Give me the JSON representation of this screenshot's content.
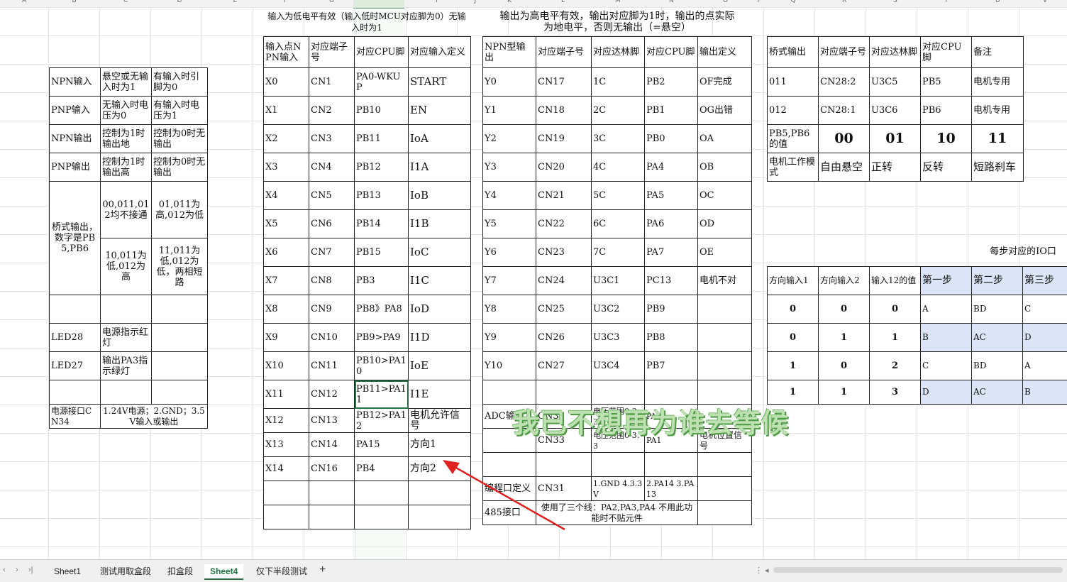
{
  "columns": [
    "A",
    "B",
    "C",
    "D",
    "E",
    "F",
    "G",
    "H",
    "I",
    "J",
    "K",
    "L",
    "M",
    "N",
    "O",
    "P",
    "Q",
    "R",
    "S",
    "T",
    "U",
    "V"
  ],
  "left_table": [
    [
      "NPN输入",
      "悬空或无输入时为1",
      "有输入时引脚为0"
    ],
    [
      "PNP输入",
      "无输入时电压为0",
      "有输入时电压为1"
    ],
    [
      "NPN输出",
      "控制为1时输出地",
      "控制为0时无输出"
    ],
    [
      "PNP输出",
      "控制为1时输出高",
      "控制为0时无输出"
    ],
    [
      "桥式输出，数字是PB5,PB6",
      "00,011,012均不接通",
      "01,011为高,012为低"
    ],
    [
      "",
      "10,011为低,012为高",
      "11,011为低,012为低，两相短路"
    ],
    [
      "",
      "",
      ""
    ],
    [
      "LED28",
      "电源指示红灯",
      ""
    ],
    [
      "LED27",
      "输出PA3指示绿灯",
      ""
    ],
    [
      "",
      "",
      ""
    ],
    [
      "电源接口CN34",
      "1.24V电源；2.GND；3.5V输入或输出",
      ""
    ]
  ],
  "input_title": "输入为低电平有效（输入低时MCU对应脚为0）无输入时为1",
  "input_headers": [
    "输入点NPN输入",
    "对应端子号",
    "对应CPU脚",
    "对应输入定义"
  ],
  "input_rows": [
    [
      "X0",
      "CN1",
      "PA0-WKUP",
      "START"
    ],
    [
      "X1",
      "CN2",
      "PB10",
      "EN"
    ],
    [
      "X2",
      "CN3",
      "PB11",
      "IoA"
    ],
    [
      "X3",
      "CN4",
      "PB12",
      "I1A"
    ],
    [
      "X4",
      "CN5",
      "PB13",
      "IoB"
    ],
    [
      "X5",
      "CN6",
      "PB14",
      "I1B"
    ],
    [
      "X6",
      "CN7",
      "PB15",
      "IoC"
    ],
    [
      "X7",
      "CN8",
      "PB3",
      "I1C"
    ],
    [
      "X8",
      "CN9",
      "PB8》PA8",
      "IoD"
    ],
    [
      "X9",
      "CN10",
      "PB9>PA9",
      "I1D"
    ],
    [
      "X10",
      "CN11",
      "PB10>PA10",
      "IoE"
    ],
    [
      "X11",
      "CN12",
      "PB11>PA11",
      "I1E"
    ],
    [
      "X12",
      "CN13",
      "PB12>PA12",
      "电机允许信号"
    ],
    [
      "X13",
      "CN14",
      "PA15",
      "方向1"
    ],
    [
      "X14",
      "CN16",
      "PB4",
      "方向2"
    ],
    [
      "",
      "",
      "",
      ""
    ],
    [
      "",
      "",
      "",
      ""
    ]
  ],
  "output_title": "输出为高电平有效，输出对应脚为1时，输出的点实际为地电平，否则无输出（=悬空）",
  "output_headers": [
    "NPN型输出",
    "对应端子号",
    "对应达林脚",
    "对应CPU脚",
    "输出定义"
  ],
  "output_rows": [
    [
      "Y0",
      "CN17",
      "1C",
      "PB2",
      "OF完成"
    ],
    [
      "Y1",
      "CN18",
      "2C",
      "PB1",
      "OG出错"
    ],
    [
      "Y2",
      "CN19",
      "3C",
      "PB0",
      "OA"
    ],
    [
      "Y3",
      "CN20",
      "4C",
      "PA4",
      "OB"
    ],
    [
      "Y4",
      "CN21",
      "5C",
      "PA5",
      "OC"
    ],
    [
      "Y5",
      "CN22",
      "6C",
      "PA6",
      "OD"
    ],
    [
      "Y6",
      "CN23",
      "7C",
      "PA7",
      "OE"
    ],
    [
      "Y7",
      "CN24",
      "U3C1",
      "PC13",
      "电机不对"
    ],
    [
      "Y8",
      "CN25",
      "U3C2",
      "PB9",
      ""
    ],
    [
      "Y9",
      "CN26",
      "U3C3",
      "PB8",
      ""
    ],
    [
      "Y10",
      "CN27",
      "U3C4",
      "PB7",
      ""
    ],
    [
      "",
      "",
      "",
      "",
      ""
    ],
    [
      "ADC输入",
      "CN32",
      "电压范围0-3.3",
      "PA2",
      ""
    ],
    [
      "",
      "CN33",
      "电压范围0-3.3",
      "PA1",
      "电机位置信号"
    ],
    [
      "",
      "",
      "",
      "",
      ""
    ],
    [
      "编程口定义",
      "CN31",
      "1.GND 4.3.3V",
      "2.PA14 3.PA13",
      ""
    ],
    [
      "485接口",
      "使用了三个线：PA2,PA3,PA4 不用此功能时不贴元件",
      "",
      "",
      ""
    ]
  ],
  "bridge_headers": [
    "桥式输出",
    "对应端子号",
    "对应达林脚",
    "对应CPU脚",
    "备注"
  ],
  "bridge_rows": [
    [
      "011",
      "CN28:2",
      "U3C5",
      "PB5",
      "电机专用"
    ],
    [
      "012",
      "CN28:1",
      "U3C6",
      "PB6",
      "电机专用"
    ]
  ],
  "bridge_value_label": "PB5,PB6的值",
  "bridge_values": [
    "00",
    "01",
    "10",
    "11"
  ],
  "bridge_mode_label": "电机工作模式",
  "bridge_modes": [
    "自由悬空",
    "正转",
    "反转",
    "短路刹车"
  ],
  "step_title": "每步对应的IO口",
  "step_headers": [
    "方向输入1",
    "方向输入2",
    "输入12的值",
    "第一步",
    "第二步",
    "第三步"
  ],
  "step_rows": [
    [
      "0",
      "0",
      "0",
      "A",
      "BD",
      "C"
    ],
    [
      "0",
      "1",
      "1",
      "B",
      "AC",
      "D"
    ],
    [
      "1",
      "0",
      "2",
      "C",
      "BD",
      "A"
    ],
    [
      "1",
      "1",
      "3",
      "D",
      "AC",
      "B"
    ]
  ],
  "watermark": "我已不想再为谁去等候",
  "sheet_tabs": [
    "Sheet1",
    "测试用取盒段",
    "扣盒段",
    "Sheet4",
    "仅下半段测试"
  ],
  "active_tab": "Sheet4"
}
